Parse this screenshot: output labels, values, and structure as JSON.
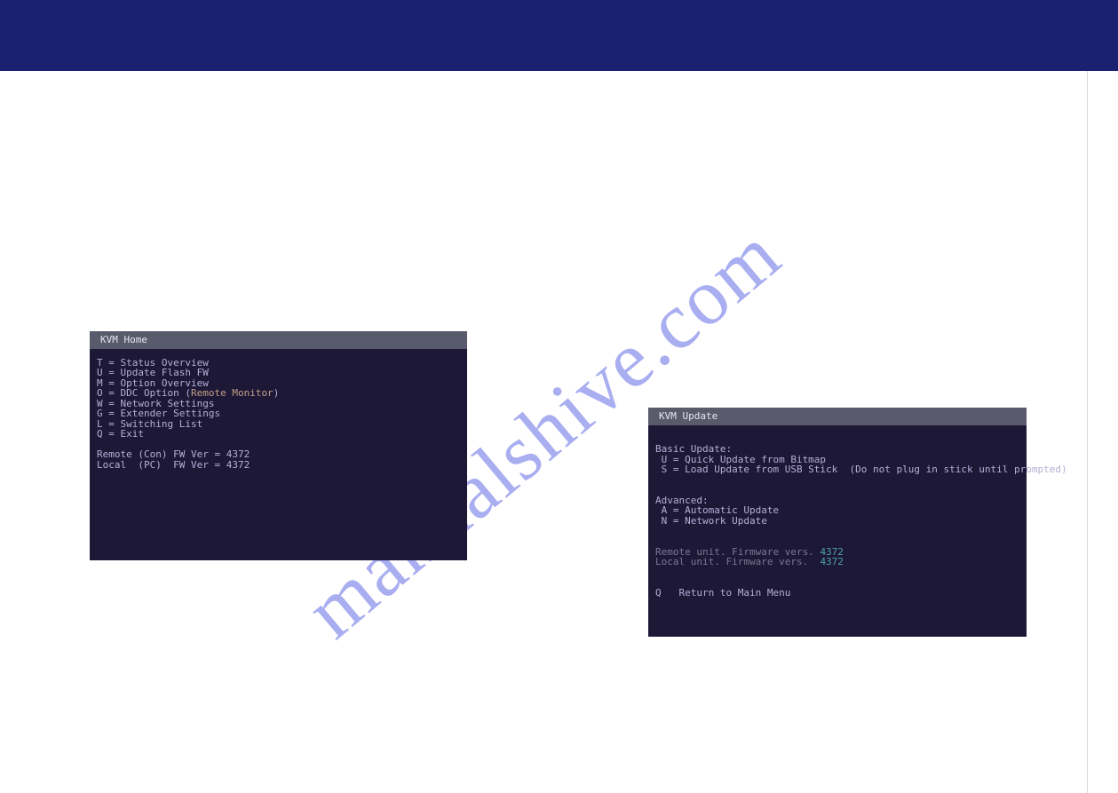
{
  "banner": {},
  "watermark": "manualshive.com",
  "kvm_home": {
    "title": "KVM Home",
    "menu": {
      "T": "T = Status Overview",
      "U": "U = Update Flash FW",
      "M": "M = Option Overview",
      "O_prefix": "O = DDC Option (",
      "O_highlight": "Remote Monitor",
      "O_suffix": ")",
      "W": "W = Network Settings",
      "G": "G = Extender Settings",
      "L": "L = Switching List",
      "Q": "Q = Exit"
    },
    "fw": {
      "remote": "Remote (Con) FW Ver = 4372",
      "local": "Local  (PC)  FW Ver = 4372"
    }
  },
  "kvm_update": {
    "title": "KVM Update",
    "basic_header": "Basic Update:",
    "basic_U": " U = Quick Update from Bitmap",
    "basic_S": " S = Load Update from USB Stick  (Do not plug in stick until prompted)",
    "adv_header": "Advanced:",
    "adv_A": " A = Automatic Update",
    "adv_N": " N = Network Update",
    "remote_prefix": "Remote unit. Firmware vers. ",
    "remote_ver": "4372",
    "local_prefix": "Local unit. Firmware vers.  ",
    "local_ver": "4372",
    "return": "Q   Return to Main Menu"
  }
}
